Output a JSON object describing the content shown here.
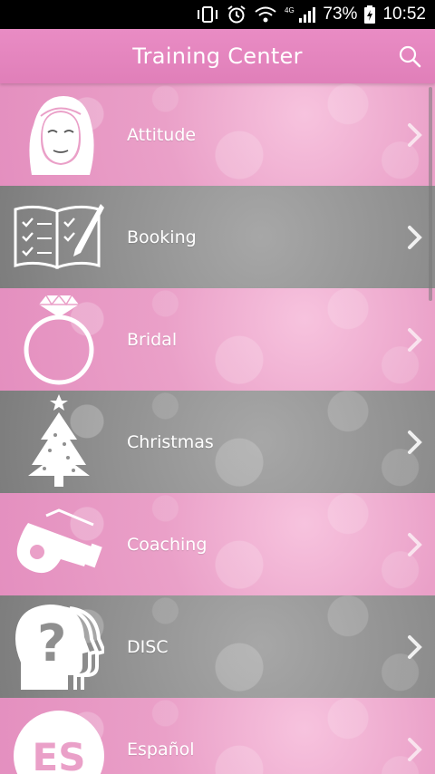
{
  "status_bar": {
    "battery": "73%",
    "time": "10:52",
    "network": "4G"
  },
  "app_bar": {
    "title": "Training Center",
    "search_icon": "search-icon"
  },
  "items": [
    {
      "label": "Attitude",
      "icon": "woman-face-icon",
      "color": "pink"
    },
    {
      "label": "Booking",
      "icon": "open-book-icon",
      "color": "gray"
    },
    {
      "label": "Bridal",
      "icon": "diamond-ring-icon",
      "color": "pink"
    },
    {
      "label": "Christmas",
      "icon": "christmas-tree-icon",
      "color": "gray"
    },
    {
      "label": "Coaching",
      "icon": "whistle-icon",
      "color": "pink"
    },
    {
      "label": "DISC",
      "icon": "head-question-icon",
      "color": "gray"
    },
    {
      "label": "Español",
      "icon": "es-badge-icon",
      "icon_text": "ES",
      "color": "pink"
    }
  ],
  "colors": {
    "header": "#e07fb9",
    "pink_row": "#e48fbf",
    "gray_row": "#8f8f8f",
    "text": "#ffffff"
  }
}
